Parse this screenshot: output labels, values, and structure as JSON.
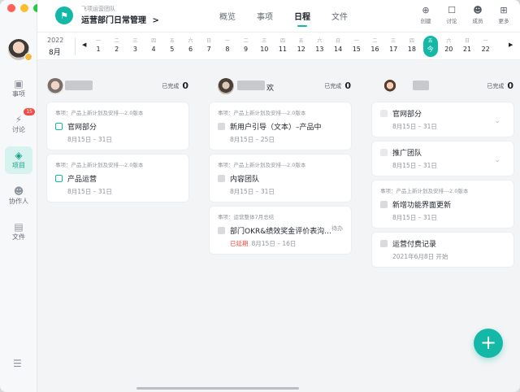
{
  "window": {
    "controls": [
      "close",
      "minimize",
      "maximize"
    ]
  },
  "sidebar": {
    "items": [
      {
        "label": "事项",
        "icon": "calendar-check-icon"
      },
      {
        "label": "讨论",
        "icon": "discussion-icon",
        "badge": "15"
      },
      {
        "label": "项目",
        "icon": "layers-icon",
        "active": true
      },
      {
        "label": "协作人",
        "icon": "people-icon"
      },
      {
        "label": "文件",
        "icon": "folder-icon"
      }
    ],
    "menu_icon": "hamburger-icon"
  },
  "header": {
    "team": "飞项运营团队",
    "project": "运营部门日常管理",
    "project_chevron": ">",
    "tabs": [
      {
        "label": "概览"
      },
      {
        "label": "事项"
      },
      {
        "label": "日程",
        "active": true
      },
      {
        "label": "文件"
      }
    ],
    "tools": [
      {
        "label": "创建",
        "icon": "plus-circle-icon",
        "glyph": "⊕"
      },
      {
        "label": "讨论",
        "icon": "chat-icon",
        "glyph": "☐"
      },
      {
        "label": "成员",
        "icon": "members-icon",
        "glyph": "☻"
      },
      {
        "label": "更多",
        "icon": "grid-icon",
        "glyph": "⊞"
      }
    ]
  },
  "calendar": {
    "year": "2022",
    "month": "8月",
    "prev": "◀",
    "next": "▶",
    "days": [
      {
        "wd": "一",
        "d": "1"
      },
      {
        "wd": "二",
        "d": "2"
      },
      {
        "wd": "三",
        "d": "3"
      },
      {
        "wd": "四",
        "d": "4"
      },
      {
        "wd": "五",
        "d": "5"
      },
      {
        "wd": "六",
        "d": "6"
      },
      {
        "wd": "日",
        "d": "7"
      },
      {
        "wd": "一",
        "d": "8"
      },
      {
        "wd": "二",
        "d": "9"
      },
      {
        "wd": "三",
        "d": "10"
      },
      {
        "wd": "四",
        "d": "11"
      },
      {
        "wd": "五",
        "d": "12"
      },
      {
        "wd": "六",
        "d": "13"
      },
      {
        "wd": "日",
        "d": "14"
      },
      {
        "wd": "一",
        "d": "15"
      },
      {
        "wd": "二",
        "d": "16"
      },
      {
        "wd": "三",
        "d": "17"
      },
      {
        "wd": "四",
        "d": "18"
      },
      {
        "wd": "五",
        "d": "今",
        "today": true
      },
      {
        "wd": "六",
        "d": "20"
      },
      {
        "wd": "日",
        "d": "21"
      },
      {
        "wd": "一",
        "d": "22"
      }
    ]
  },
  "columns": [
    {
      "name": "",
      "done_label": "已完成",
      "done_count": "0",
      "cards": [
        {
          "meta": "事项：产品上新计划及安排---2.0版本",
          "title": "官网部分",
          "date": "8月15日 – 31日",
          "check": "teal"
        },
        {
          "meta": "事项：产品上新计划及安排---2.0版本",
          "title": "产品运营",
          "date": "8月15日 – 31日",
          "check": "teal"
        }
      ]
    },
    {
      "name": "欢",
      "done_label": "已完成",
      "done_count": "0",
      "cards": [
        {
          "meta": "事项：产品上新计划及安排---2.0版本",
          "title": "新用户引导（文本）–产品中",
          "date": "8月15日 – 25日",
          "check": "gray"
        },
        {
          "meta": "事项：产品上新计划及安排---2.0版本",
          "title": "内容团队",
          "date": "8月15日 – 31日",
          "check": "gray"
        },
        {
          "meta": "事项：运营整体7月总结",
          "title": "部门OKR&绩效奖金评价表沟...",
          "overdue": "已延期",
          "date": "8月15日 – 16日",
          "status": "待办",
          "check": "gray"
        }
      ]
    },
    {
      "name": "",
      "done_label": "已完成",
      "done_count": "0",
      "cards": [
        {
          "meta": "",
          "title": "官网部分",
          "date": "8月15日 – 31日",
          "check": "light",
          "chevron": "⌄"
        },
        {
          "meta": "",
          "title": "推广团队",
          "date": "8月15日 – 31日",
          "check": "light",
          "chevron": "⌄"
        },
        {
          "meta": "事项：产品上新计划及安排---2.0版本",
          "title": "新增功能界面更新",
          "date": "8月15日 – 31日",
          "check": "gray"
        },
        {
          "meta": "",
          "title": "运营付费记录",
          "date": "2021年6月8日 开始",
          "check": "gray"
        }
      ]
    }
  ],
  "fab": {
    "label": "+",
    "icon": "add-icon"
  },
  "colors": {
    "accent": "#14b8a6",
    "overdue": "#f54a45",
    "badge": "#f54a45"
  }
}
